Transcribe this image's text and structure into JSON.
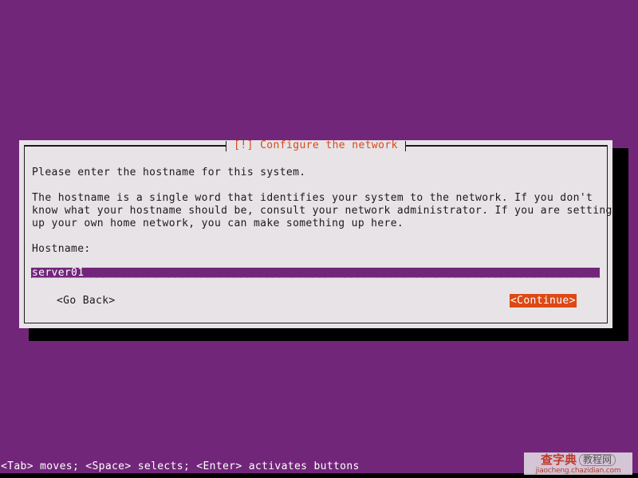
{
  "screen": {
    "background_color": "#72267a",
    "shadow_color": "#000000"
  },
  "dialog": {
    "title": "[!] Configure the network",
    "title_color": "#dd4814",
    "panel_color": "#e7e3e7",
    "border_color": "#1d1a1d",
    "intro_line": "Please enter the hostname for this system.",
    "description": "The hostname is a single word that identifies your system to the network. If you don't\nknow what your hostname should be, consult your network administrator. If you are setting\nup your own home network, you can make something up here.",
    "field": {
      "label": "Hostname:",
      "value": "server01",
      "filler": "________________________________________________________________________________________",
      "field_background": "#72267a",
      "field_text_color": "#ffffff"
    },
    "buttons": {
      "go_back": "<Go Back>",
      "continue": "<Continue>",
      "continue_background": "#dd4814",
      "continue_text_color": "#ffffff"
    }
  },
  "status_bar": {
    "text": "<Tab> moves; <Space> selects; <Enter> activates buttons",
    "background_color": "#72267a",
    "text_color": "#ffffff"
  },
  "watermark": {
    "logo_main": "查字典",
    "logo_sub": "教程网",
    "url": "jiaocheng.chazidian.com"
  }
}
